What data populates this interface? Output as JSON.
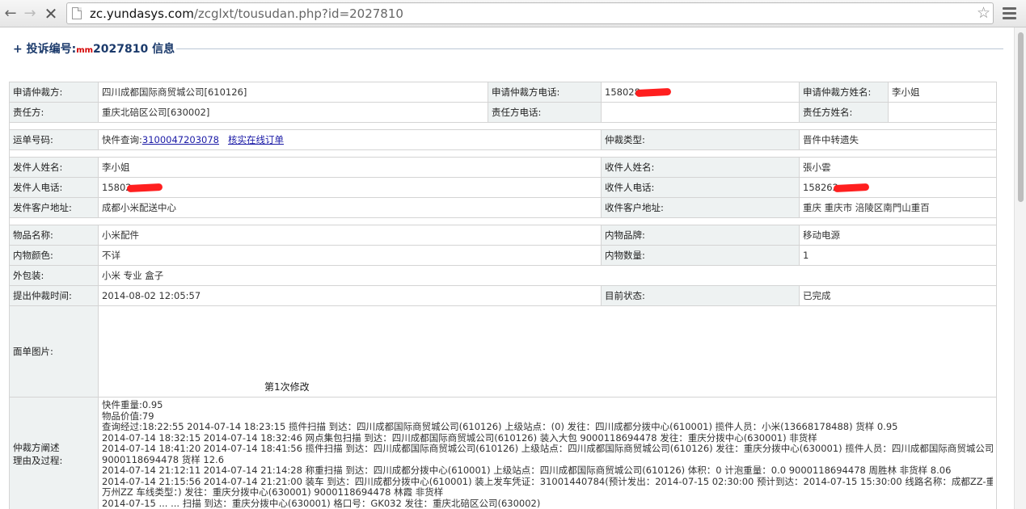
{
  "browser": {
    "url_host": "zc.yundasys.com",
    "url_path": "/zcglxt/tousudan.php?id=2027810"
  },
  "header": {
    "prefix": "+ 投诉编号:",
    "mark": "mm",
    "id_info": "2027810 信息"
  },
  "row1": {
    "applicant_label": "申请仲裁方:",
    "applicant_value": "四川成都国际商贸城公司[610126]",
    "applicant_phone_label": "申请仲裁方电话:",
    "applicant_phone_value": "158028",
    "applicant_name_label": "申请仲裁方姓名:",
    "applicant_name_value": "李小姐"
  },
  "row2": {
    "resp_label": "责任方:",
    "resp_value": "重庆北碚区公司[630002]",
    "resp_phone_label": "责任方电话:",
    "resp_phone_value": "",
    "resp_name_label": "责任方姓名:",
    "resp_name_value": ""
  },
  "waybill": {
    "label": "运单号码:",
    "query_prefix": "快件查询:",
    "number": "3100047203078",
    "verify_link": "核实在线订单",
    "type_label": "仲裁类型:",
    "type_value": "晋件中转遗失"
  },
  "sender": {
    "name_label": "发件人姓名:",
    "name_value": "李小姐",
    "phone_label": "发件人电话:",
    "phone_value": "15802",
    "addr_label": "发件客户地址:",
    "addr_value": "成都小米配送中心"
  },
  "receiver": {
    "name_label": "收件人姓名:",
    "name_value": "張小雲",
    "phone_label": "收件人电话:",
    "phone_value": "158262",
    "addr_label": "收件客户地址:",
    "addr_value": "重庆 重庆市 涪陵区南門山重百"
  },
  "goods": {
    "name_label": "物品名称:",
    "name_value": "小米配件",
    "brand_label": "内物品牌:",
    "brand_value": "移动电源",
    "color_label": "内物颜色:",
    "color_value": "不详",
    "qty_label": "内物数量:",
    "qty_value": "1",
    "pack_label": "外包装:",
    "pack_value": "小米 专业 盒子"
  },
  "status": {
    "time_label": "提出仲裁时间:",
    "time_value": "2014-08-02 12:05:57",
    "state_label": "目前状态:",
    "state_value": "已完成"
  },
  "image": {
    "label": "面单图片:",
    "caption": "第1次修改"
  },
  "process": {
    "label_line1": "仲裁方阐述",
    "label_line2": "理由及过程:",
    "lines": [
      "快件重量:0.95",
      "物品价值:79",
      "查询经过:18:22:55 2014-07-14 18:23:15 揽件扫描 到达：四川成都国际商贸城公司(610126) 上级站点：(0) 发往：四川成都分拨中心(610001) 揽件人员：小米(13668178488) 货样 0.95",
      "2014-07-14 18:32:15 2014-07-14 18:32:46 网点集包扫描 到达：四川成都国际商贸城公司(610126) 装入大包 9000118694478 发往：重庆分拨中心(630001) 非货样",
      "2014-07-14 18:41:20 2014-07-14 18:41:56 揽件扫描 到达：四川成都国际商贸城公司(610126) 上级站点：四川成都国际商贸城公司(610126) 发往：重庆分拨中心(630001) 揽件人员：四川成都国际商贸城公司",
      "9000118694478 货样 12.6",
      "2014-07-14 21:12:11 2014-07-14 21:14:28 称重扫描 到达：四川成都分拨中心(610001) 上级站点：四川成都国际商贸城公司(610126) 体积：0 计泡重量：0.0 9000118694478 周胜林 非货样 8.06",
      "2014-07-14 21:15:56 2014-07-14 21:21:00 装车 到达：四川成都分拨中心(610001) 装上发车凭证：31001440784(预计发出：2014-07-15 02:30:00 预计到达：2014-07-15 15:30:00 线路名称：成都ZZ-重庆ZZ-",
      "万州ZZ 车线类型：) 发往：重庆分拨中心(630001) 9000118694478 林霞 非货样",
      "2014-07-15 ... ... 扫描 到达：重庆分拨中心(630001) 格口号：GK032 发往：重庆北碚区公司(630002)"
    ]
  },
  "colors": {
    "label_bg": "#eef2f2",
    "heading": "#1b3a6b",
    "link": "#1a1aa6",
    "status_done": "#2a7a2a",
    "redaction": "#ff1f1f"
  }
}
